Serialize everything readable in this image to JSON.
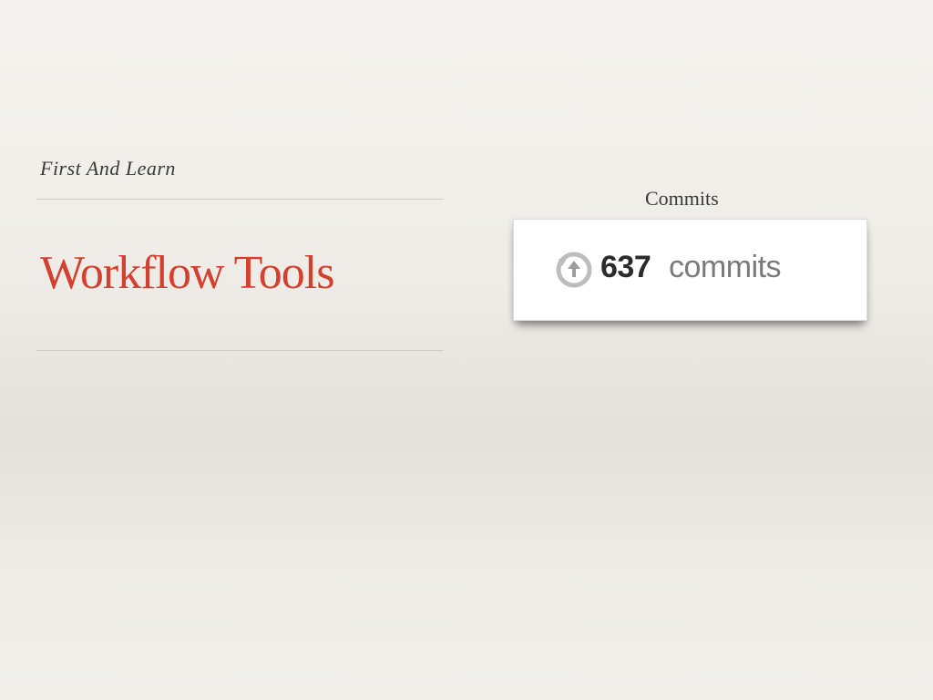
{
  "slide": {
    "subtitle": "First And Learn",
    "title": "Workflow Tools",
    "title_color": "#d4402f",
    "caption": "Commits"
  },
  "commits_card": {
    "icon": "history-icon",
    "count": "637",
    "label": "commits"
  }
}
